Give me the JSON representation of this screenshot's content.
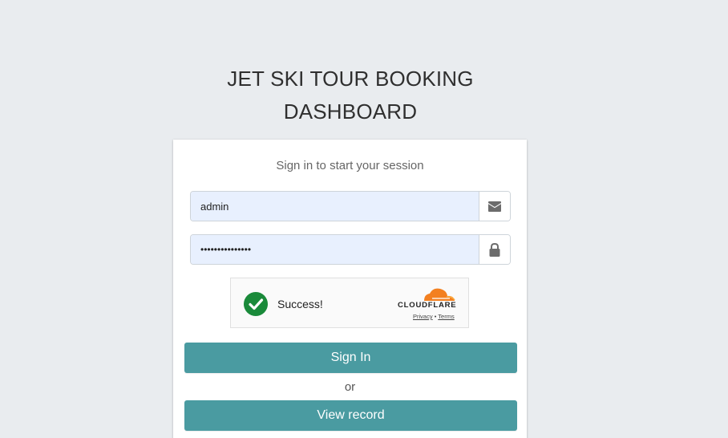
{
  "header": {
    "title_line1": "JET SKI TOUR BOOKING",
    "title_line2": "DASHBOARD"
  },
  "login": {
    "subtitle": "Sign in to start your session",
    "email_value": "admin",
    "email_icon": "envelope-icon",
    "password_value": "•••••••••••••••",
    "password_icon": "lock-icon",
    "signin_label": "Sign In",
    "or_label": "or",
    "view_record_label": "View record"
  },
  "turnstile": {
    "status": "Success!",
    "brand": "CLOUDFLARE",
    "privacy": "Privacy",
    "separator": "•",
    "terms": "Terms"
  },
  "colors": {
    "background": "#e9ecef",
    "button": "#4a9ba1",
    "input_fill": "#e8f0fe",
    "success_green": "#1a8a3a",
    "cloudflare_orange": "#f38020"
  }
}
